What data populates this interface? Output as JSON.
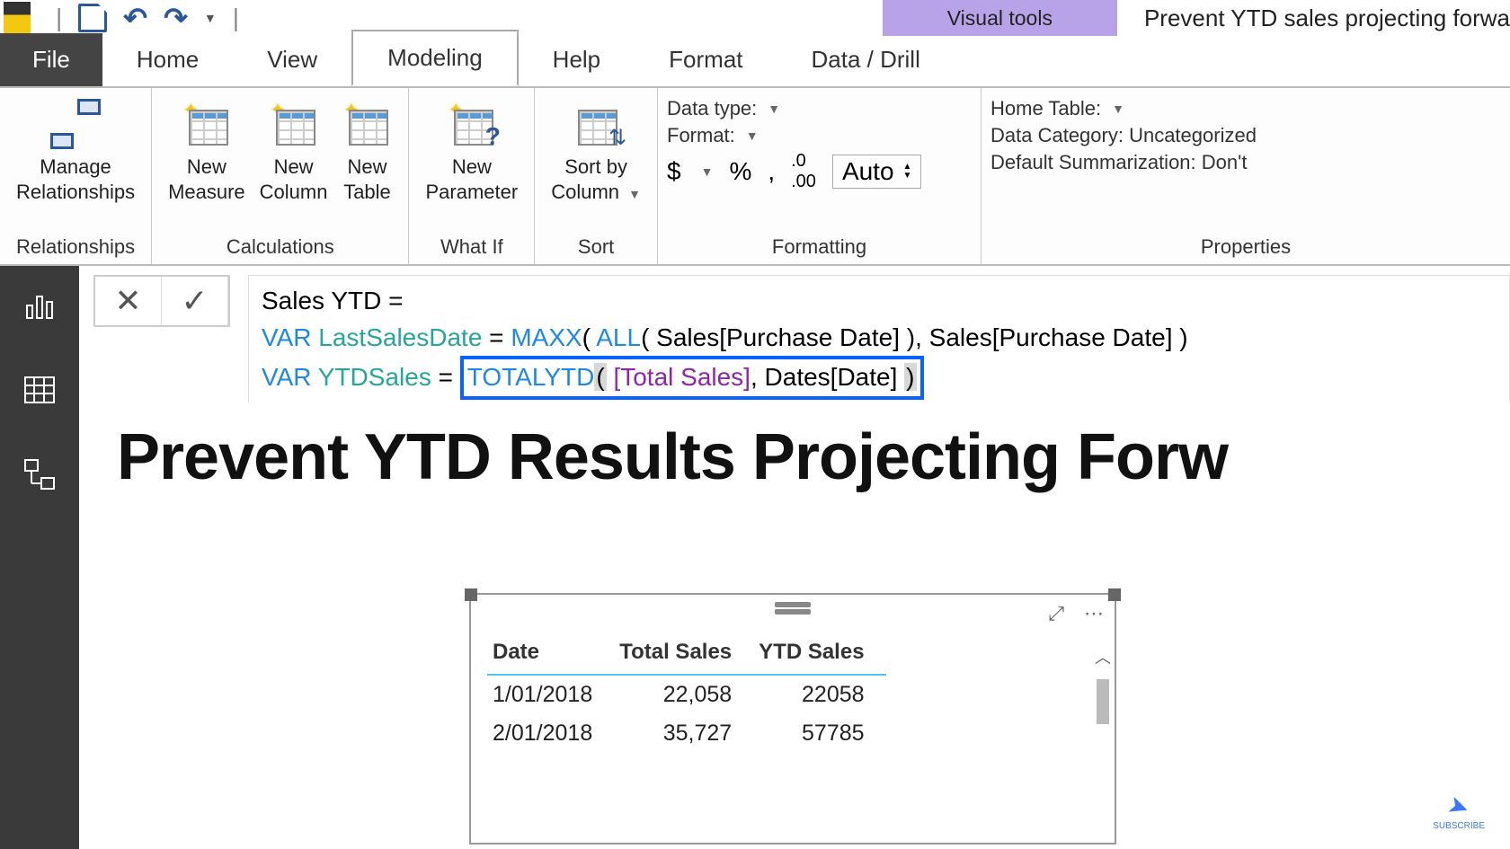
{
  "titleBar": {
    "visualTools": "Visual tools",
    "docTitle": "Prevent YTD sales projecting forwa"
  },
  "tabs": {
    "file": "File",
    "home": "Home",
    "view": "View",
    "modeling": "Modeling",
    "help": "Help",
    "format": "Format",
    "dataDrill": "Data / Drill"
  },
  "ribbon": {
    "relationships": {
      "manage": "Manage\nRelationships",
      "groupLabel": "Relationships"
    },
    "calculations": {
      "newMeasure": "New\nMeasure",
      "newColumn": "New\nColumn",
      "newTable": "New\nTable",
      "groupLabel": "Calculations"
    },
    "whatIf": {
      "newParameter": "New\nParameter",
      "groupLabel": "What If"
    },
    "sort": {
      "sortBy": "Sort by\nColumn",
      "groupLabel": "Sort"
    },
    "formatting": {
      "dataTypeLabel": "Data type:",
      "formatLabel": "Format:",
      "currency": "$",
      "percent": "%",
      "comma": ",",
      "decimals": ".00",
      "auto": "Auto",
      "groupLabel": "Formatting"
    },
    "properties": {
      "homeTable": "Home Table:",
      "dataCategory": "Data Category: Uncategorized",
      "defaultSummarization": "Default Summarization: Don't",
      "groupLabel": "Properties"
    }
  },
  "formula": {
    "line1_measure": "Sales YTD",
    "line1_rest": " = ",
    "line2": {
      "var": "VAR",
      "name": "LastSalesDate",
      "eq": " = ",
      "maxx": "MAXX",
      "open": "( ",
      "all": "ALL",
      "allOpen": "( ",
      "col1": "Sales[Purchase Date]",
      "allClose": " )",
      "comma": ", ",
      "col2": "Sales[Purchase Date]",
      "close": " )"
    },
    "line3": {
      "var": "VAR",
      "name": "YTDSales",
      "eq": " = ",
      "totalytd": "TOTALYTD",
      "open": "(",
      "sp1": " ",
      "meas": "[Total Sales]",
      "comma": ", ",
      "col": "Dates[Date]",
      "sp2": " ",
      "close": ")"
    }
  },
  "canvas": {
    "heading": "Prevent YTD Results Projecting Forw"
  },
  "table": {
    "headers": [
      "Date",
      "Total Sales",
      "YTD Sales"
    ],
    "rows": [
      {
        "date": "1/01/2018",
        "total": "22,058",
        "ytd": "22058"
      },
      {
        "date": "2/01/2018",
        "total": "35,727",
        "ytd": "57785"
      }
    ]
  },
  "subscribe": "SUBSCRIBE"
}
